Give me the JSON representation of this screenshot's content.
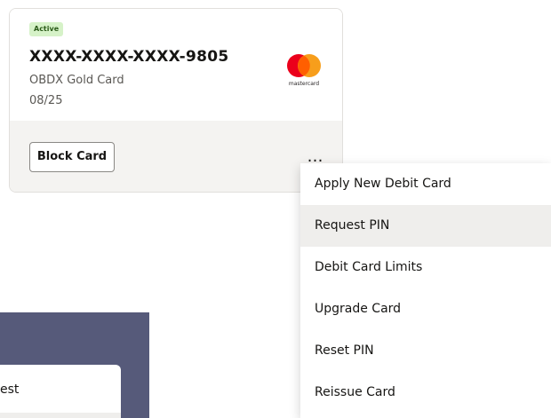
{
  "card": {
    "status": "Active",
    "number": "XXXX-XXXX-XXXX-9805",
    "name": "OBDX Gold Card",
    "expiry": "08/25",
    "network_logo_text": "mastercard",
    "network_icon": "mastercard-logo",
    "block_label": "Block Card",
    "more_label": "…"
  },
  "menu": {
    "items": [
      {
        "label": "Apply New Debit Card"
      },
      {
        "label": "Request PIN"
      },
      {
        "label": "Debit Card Limits"
      },
      {
        "label": "Upgrade Card"
      },
      {
        "label": "Reset PIN"
      },
      {
        "label": "Reissue Card"
      }
    ],
    "highlighted_index": 1
  },
  "background_popup": {
    "visible_text": "est"
  },
  "colors": {
    "badge_bg": "#d6f2c8",
    "badge_text": "#2c5c1a",
    "mc_red": "#eb001b",
    "mc_orange": "#f79e1b",
    "mc_overlap": "#ff5f00",
    "overlay_panel": "#565a7a",
    "highlight": "#efeeec"
  }
}
